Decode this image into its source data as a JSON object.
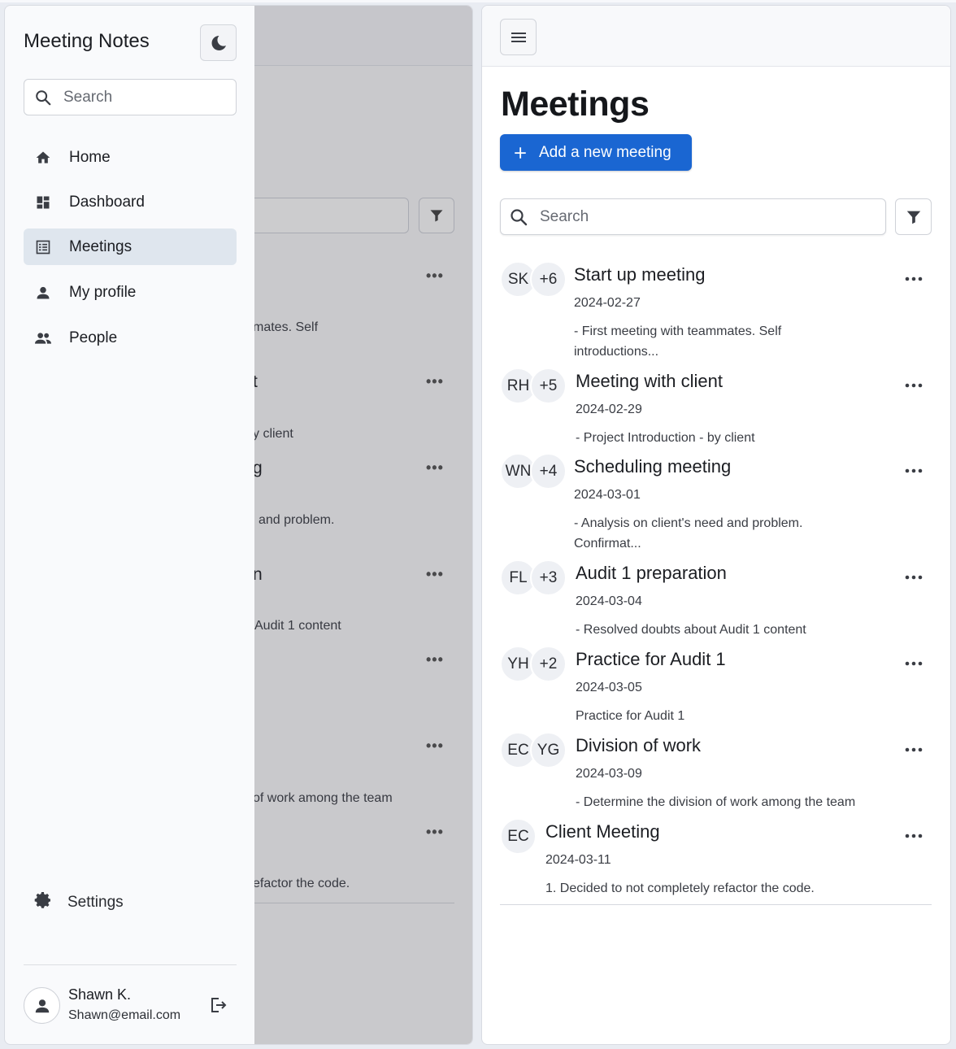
{
  "drawer": {
    "title": "Meeting Notes",
    "search_placeholder": "Search",
    "nav": [
      {
        "label": "Home",
        "icon": "home-icon",
        "active": false
      },
      {
        "label": "Dashboard",
        "icon": "dashboard-icon",
        "active": false
      },
      {
        "label": "Meetings",
        "icon": "meetings-list-icon",
        "active": true
      },
      {
        "label": "My profile",
        "icon": "person-icon",
        "active": false
      },
      {
        "label": "People",
        "icon": "people-icon",
        "active": false
      }
    ],
    "settings_label": "Settings",
    "user": {
      "name": "Shawn K.",
      "email": "Shawn@email.com"
    }
  },
  "background_fragments": [
    "mates. Self",
    "t",
    "y client",
    "g",
    "and problem.",
    "n",
    "Audit 1 content",
    "of work among the team",
    "efactor the code."
  ],
  "main": {
    "title": "Meetings",
    "add_button_label": "Add a new meeting",
    "search_placeholder": "Search",
    "meetings": [
      {
        "initials": "SK",
        "extra": "+6",
        "title": "Start up meeting",
        "date": "2024-02-27",
        "description": "- First meeting with teammates. Self introductions..."
      },
      {
        "initials": "RH",
        "extra": "+5",
        "title": "Meeting with client",
        "date": "2024-02-29",
        "description": "- Project Introduction - by client"
      },
      {
        "initials": "WN",
        "extra": "+4",
        "title": "Scheduling meeting",
        "date": "2024-03-01",
        "description": "- Analysis on client's need and problem. Confirmat..."
      },
      {
        "initials": "FL",
        "extra": "+3",
        "title": "Audit 1 preparation",
        "date": "2024-03-04",
        "description": "- Resolved doubts about Audit 1 content"
      },
      {
        "initials": "YH",
        "extra": "+2",
        "title": "Practice for Audit 1",
        "date": "2024-03-05",
        "description": "Practice for Audit 1"
      },
      {
        "initials": "EC",
        "extra": "YG",
        "title": "Division of work",
        "date": "2024-03-09",
        "description": "- Determine the division of work among the team"
      },
      {
        "initials": "EC",
        "extra": "",
        "title": "Client Meeting",
        "date": "2024-03-11",
        "description": "1. Decided to not completely refactor the code."
      }
    ]
  },
  "colors": {
    "accent": "#1a66d2",
    "active_nav": "#dfe6ee"
  }
}
